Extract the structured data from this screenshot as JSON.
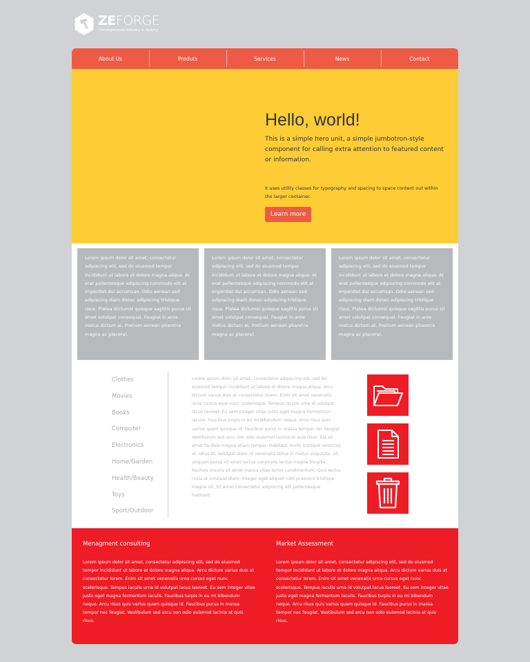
{
  "brand": {
    "name_bold": "ZE",
    "name_light": "FORGE",
    "tagline": "Developmental Industry & Tacking"
  },
  "nav": {
    "items": [
      "About Us",
      "Produts",
      "Services",
      "News",
      "Contact"
    ]
  },
  "hero": {
    "title": "Hello, world!",
    "lead": "This is a simple hero unit, a simple jumbotron-style component for calling extra attention to featured content or information.",
    "small": "It uses utility classes for typography and spacing to space content out within the larger container.",
    "button_label": "Learn more"
  },
  "cards": [
    "Lorem ipsum dolor sit amet, consectetur adipiscing elit, sed do eiusmod tempor incididunt ut labore et dolore magna aliqua. At erat pellentesque adipiscing commodo elit at imperdiet dui accumsan. Odio aenean sed adipiscing diam donec adipiscing tristique risus. Platea dictumst quisque sagittis purus sit amet volutpat consequat. Feugiat in ante metus dictum at. Pretium aenean pharetra magna ac placerat.",
    "Lorem ipsum dolor sit amet, consectetur adipiscing elit, sed do eiusmod tempor incididunt ut labore et dolore magna aliqua. At erat pellentesque adipiscing commodo elit at imperdiet dui accumsan. Odio aenean sed adipiscing diam donec adipiscing tristique risus. Platea dictumst quisque sagittis purus sit amet volutpat consequat. Feugiat in ante metus dictum at. Pretium aenean pharetra magna ac placerat.",
    "Lorem ipsum dolor sit amet, consectetur adipiscing elit, sed do eiusmod tempor incididunt ut labore et dolore magna aliqua. At erat pellentesque adipiscing commodo elit at imperdiet dui accumsan. Odio aenean sed adipiscing diam donec adipiscing tristique risus. Platea dictumst quisque sagittis purus sit amet volutpat consequat. Feugiat in ante metus dictum at. Pretium aenean pharetra magna ac placerat."
  ],
  "sidebar": {
    "items": [
      "Clothes",
      "Movies",
      "Books",
      "Computer",
      "Electronics",
      "Home/Garden",
      "Health/Beauty",
      "Toys",
      "Sport/Outdoor"
    ]
  },
  "middle_text": "Lorem ipsum dolor sit amet, consectetur adipiscing elit, sed do eiusmod tempor incididunt ut labore et dolore magna aliqua. Arcu dictum varius duis at consectetur lorem. Enim sit amet venenatis urna cursus eget nunc scelerisque. Tempus iaculis urna id volutpat lacus laoreet. Eu sem integer vitae justo eget magna fermentum iaculis. Faucibus turpis in eu mi bibendum neque. Arcu risus quis varius quam quisque id. Faucibus purus in massa tempor nec feugiat. Vestibulum sed arcu non odio euismod lacinia at quis risus. Est sit amet facilisis magna etiam tempor. Habitant morbi tristique senectus et netus et. Volutpat diam ut venenatis tellus in metus vulputate. Ut aliquam purus sit amet luctus venenatis lectus magna fringilla. Facilisis mauris sit amet massa vitae tortor condimentum. Quis lectus nulla at volutpat diam. Integer eget aliquet nibh praesent tristique magna sit. Sit amet consectetur adipiscing elit pellentesque habitant.",
  "icons": [
    "folder-icon",
    "document-icon",
    "trash-icon"
  ],
  "bottom": {
    "left_title": "Menagment consulting",
    "left_text": "Lorem ipsum dolor sit amet, consectetur adipiscing elit, sed do eiusmod tempor incididunt ut labore et dolore magna aliqua. Arcu dictum varius duis at consectetur lorem. Enim sit amet venenatis urna cursus eget nunc scelerisque. Tempus iaculis urna id volutpat lacus laoreet. Eu sem integer vitae justo eget magna fermentum iaculis. Faucibus turpis in eu mi bibendum neque. Arcu risus quis varius quam quisque id. Faucibus purus in massa tempor nec feugiat. Vestibulum sed arcu non odio euismod lacinia at quis risus.",
    "right_title": "Market Assessment",
    "right_text": "Lorem ipsum dolor sit amet, consectetur adipiscing elit, sed do eiusmod tempor incididunt ut labore et dolore magna aliqua. Arcu dictum varius duis at consectetur lorem. Enim sit amet venenatis urna cursus eget nunc scelerisque. Tempus iaculis urna id volutpat lacus laoreet. Eu sem integer vitae justo eget magna fermentum iaculis. Faucibus turpis in eu mi bibendum neque. Arcu risus quis varius quam quisque id. Faucibus purus in massa tempor nec feugiat. Vestibulum sed arcu non odio euismod lacinia at quis risus."
  },
  "colors": {
    "nav": "#ee5b44",
    "hero": "#fecd36",
    "card": "#b8b9bd",
    "accent_red": "#ee1c25",
    "background": "#d1d2d5"
  }
}
